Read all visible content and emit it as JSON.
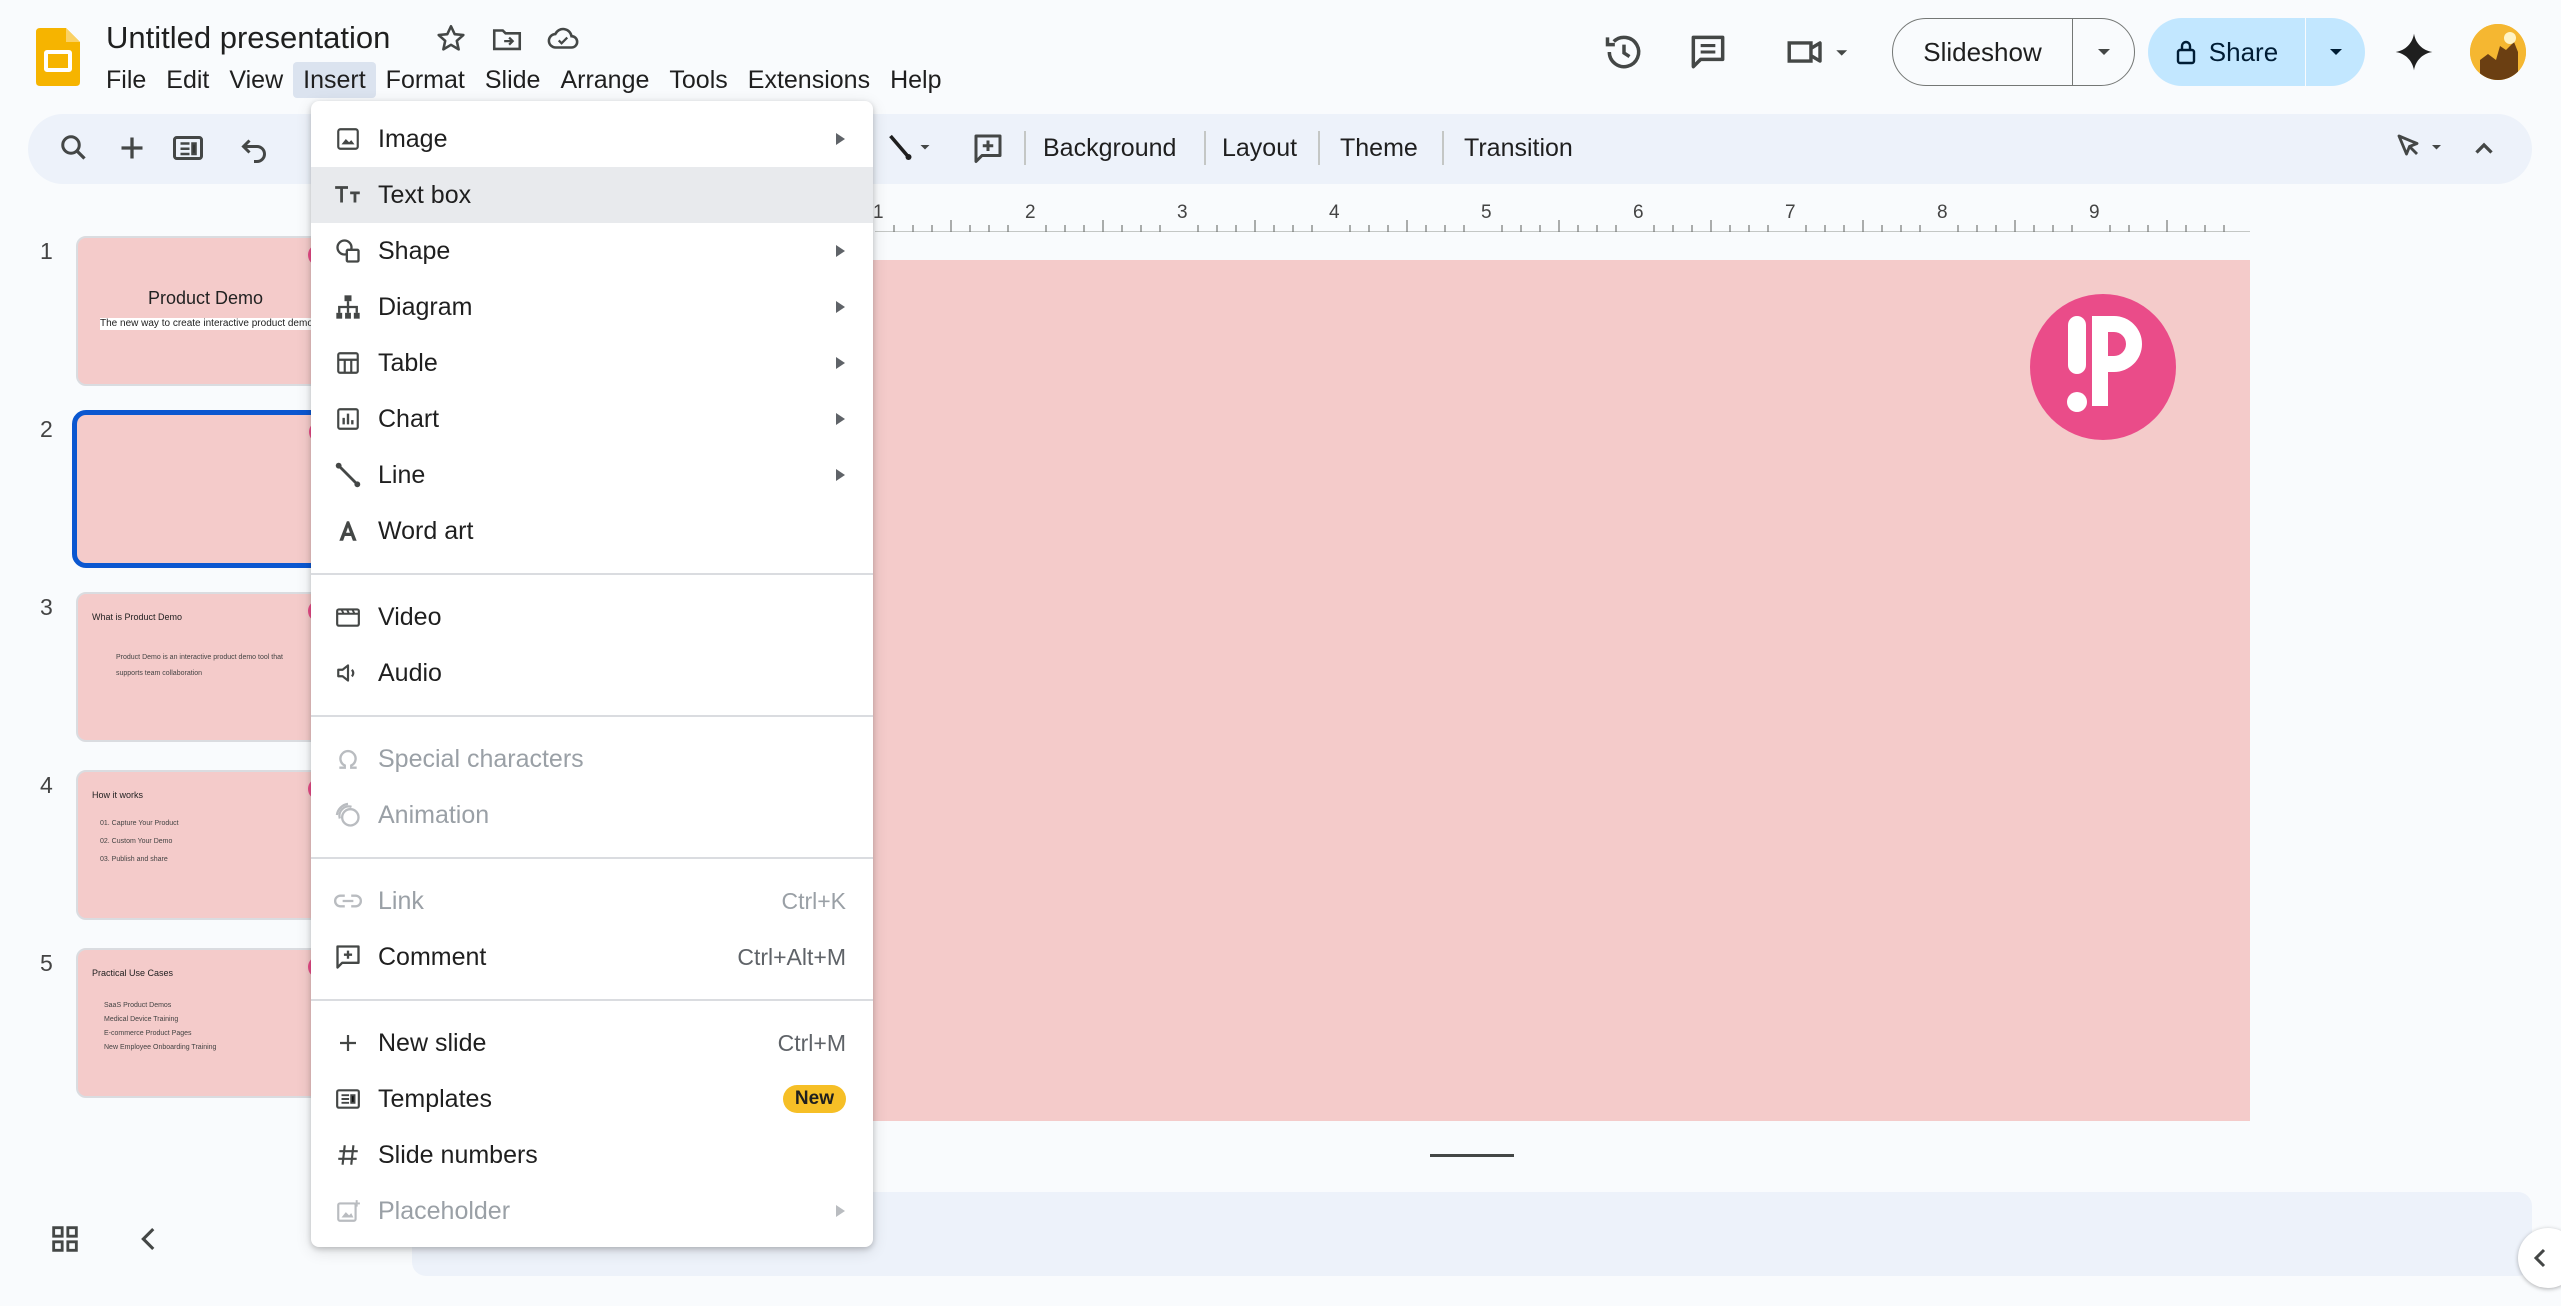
{
  "header": {
    "doc_title": "Untitled presentation",
    "menus": [
      "File",
      "Edit",
      "View",
      "Insert",
      "Format",
      "Slide",
      "Arrange",
      "Tools",
      "Extensions",
      "Help"
    ],
    "active_menu": "Insert",
    "slideshow_label": "Slideshow",
    "share_label": "Share"
  },
  "toolbar": {
    "background_label": "Background",
    "layout_label": "Layout",
    "theme_label": "Theme",
    "transition_label": "Transition"
  },
  "ruler": {
    "marks": [
      "1",
      "2",
      "3",
      "4",
      "5",
      "6",
      "7",
      "8",
      "9"
    ]
  },
  "slides": [
    {
      "number": "1",
      "title": "Product Demo",
      "subtitle": "The new way to create interactive product demo"
    },
    {
      "number": "2"
    },
    {
      "number": "3",
      "title": "What is Product Demo",
      "lines": [
        "Product Demo is an interactive product demo tool that",
        "supports team collaboration"
      ]
    },
    {
      "number": "4",
      "title": "How it works",
      "lines": [
        "01. Capture Your Product",
        "02. Custom Your Demo",
        "03. Publish and share"
      ]
    },
    {
      "number": "5",
      "title": "Practical Use Cases",
      "lines": [
        "SaaS Product Demos",
        "Medical Device Training",
        "E-commerce Product Pages",
        "New Employee Onboarding Training"
      ]
    }
  ],
  "insert_menu": {
    "items": [
      {
        "label": "Image",
        "icon": "image-icon",
        "submenu": true
      },
      {
        "label": "Text box",
        "icon": "text-box-icon",
        "hover": true
      },
      {
        "label": "Shape",
        "icon": "shape-icon",
        "submenu": true
      },
      {
        "label": "Diagram",
        "icon": "diagram-icon",
        "submenu": true
      },
      {
        "label": "Table",
        "icon": "table-icon",
        "submenu": true
      },
      {
        "label": "Chart",
        "icon": "chart-icon",
        "submenu": true
      },
      {
        "label": "Line",
        "icon": "line-icon",
        "submenu": true
      },
      {
        "label": "Word art",
        "icon": "word-art-icon"
      },
      {
        "label": "Video",
        "icon": "video-icon"
      },
      {
        "label": "Audio",
        "icon": "audio-icon"
      },
      {
        "label": "Special characters",
        "icon": "omega-icon",
        "disabled": true
      },
      {
        "label": "Animation",
        "icon": "animation-icon",
        "disabled": true
      },
      {
        "label": "Link",
        "icon": "link-icon",
        "disabled": true,
        "shortcut": "Ctrl+K"
      },
      {
        "label": "Comment",
        "icon": "comment-add-icon",
        "shortcut": "Ctrl+Alt+M"
      },
      {
        "label": "New slide",
        "icon": "plus-icon",
        "shortcut": "Ctrl+M"
      },
      {
        "label": "Templates",
        "icon": "templates-icon",
        "badge": "New"
      },
      {
        "label": "Slide numbers",
        "icon": "hash-icon"
      },
      {
        "label": "Placeholder",
        "icon": "placeholder-icon",
        "submenu": true,
        "disabled": true
      }
    ]
  },
  "colors": {
    "slide_bg": "#f4cbca",
    "brand_pink": "#ea4c89",
    "accent_blue": "#0b57d0"
  }
}
